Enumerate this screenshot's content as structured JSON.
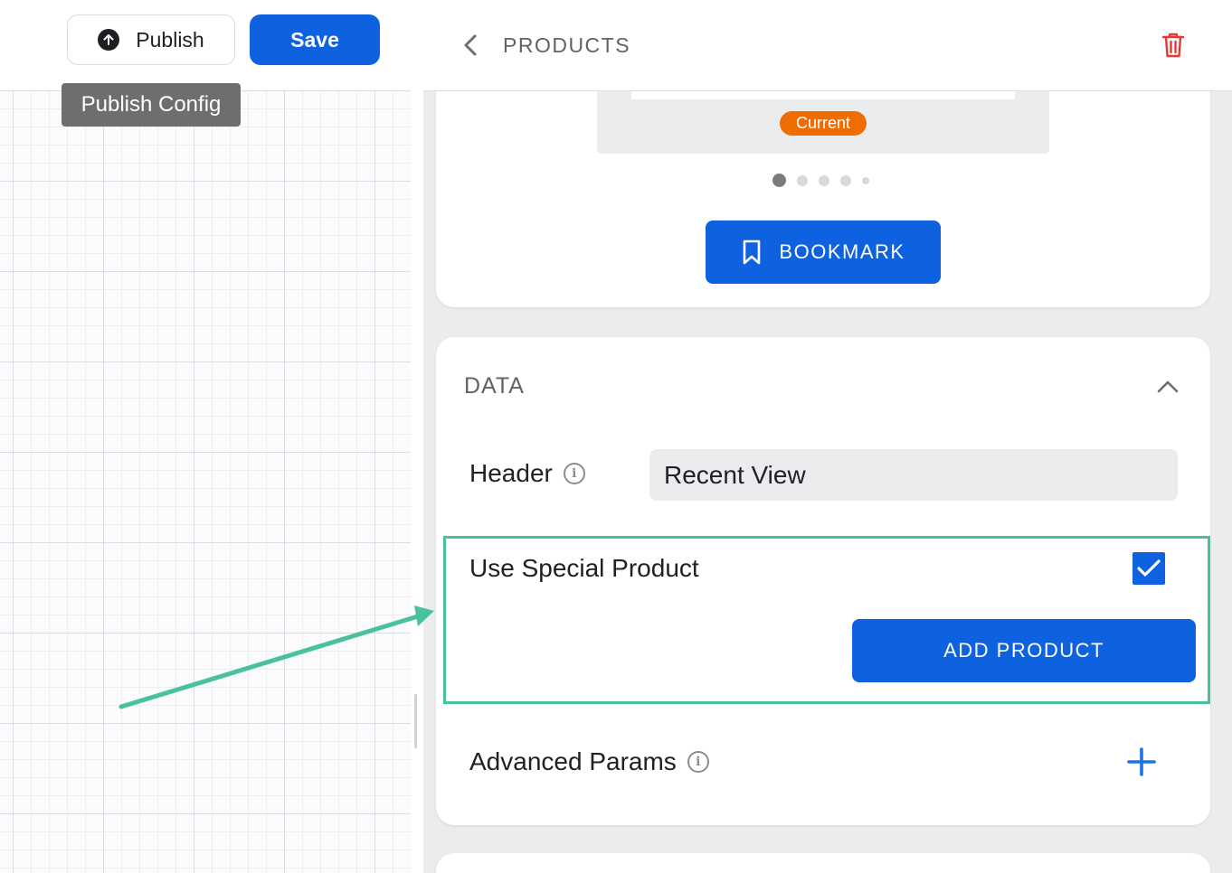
{
  "toolbar": {
    "publish_label": "Publish",
    "save_label": "Save",
    "tooltip": "Publish Config"
  },
  "panel": {
    "title": "PRODUCTS",
    "preview": {
      "badge": "Current",
      "carousel_pages": 5,
      "carousel_active": 1
    },
    "bookmark_label": "BOOKMARK",
    "data_section": {
      "title": "DATA",
      "header_label": "Header",
      "header_value": "Recent View",
      "special_label": "Use Special Product",
      "special_checked": true,
      "add_product_label": "ADD PRODUCT",
      "advanced_label": "Advanced Params"
    }
  },
  "icons": [
    "arrow-up-circle-icon",
    "chevron-left-icon",
    "trash-icon",
    "bookmark-icon",
    "chevron-up-icon",
    "info-icon",
    "checkmark-icon",
    "plus-icon"
  ],
  "colors": {
    "primary": "#0e62e0",
    "badge": "#ef6c00",
    "danger": "#e53935",
    "highlight": "#4ac19e"
  }
}
